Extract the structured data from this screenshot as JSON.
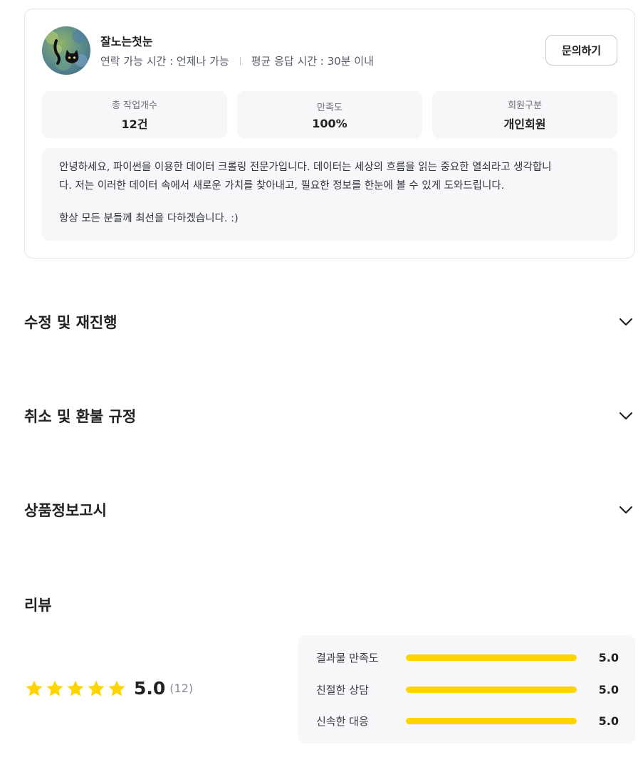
{
  "seller": {
    "name": "잘노는첫눈",
    "contact_time": "연락 가능 시간 : 언제나 가능",
    "avg_response": "평균 응답 시간 : 30분 이내",
    "inquiry_button": "문의하기",
    "stats": [
      {
        "label": "총 작업개수",
        "value": "12건"
      },
      {
        "label": "만족도",
        "value": "100%"
      },
      {
        "label": "회원구분",
        "value": "개인회원"
      }
    ],
    "intro_line1": "안녕하세요, 파이썬을 이용한 데이터 크롤링 전문가입니다. 데이터는 세상의 흐름을 읽는 중요한 열쇠라고 생각합니\n다. 저는 이러한 데이터 속에서 새로운 가치를 찾아내고, 필요한 정보를 한눈에 볼 수 있게 도와드립니다.",
    "intro_line2": "항상 모든 분들께 최선을 다하겠습니다. :)",
    "avatar_icon": "cat-avatar-image"
  },
  "accordions": [
    {
      "title": "수정 및 재진행",
      "icon": "chevron-down-icon"
    },
    {
      "title": "취소 및 환불 규정",
      "icon": "chevron-down-icon"
    },
    {
      "title": "상품정보고시",
      "icon": "chevron-down-icon"
    }
  ],
  "reviews": {
    "title": "리뷰",
    "rating": "5.0",
    "rating_value": 5.0,
    "count": "(12)",
    "star_color": "#ffd400",
    "breakdown": [
      {
        "label": "결과물 만족도",
        "score": "5.0",
        "fraction": 1.0
      },
      {
        "label": "친절한 상담",
        "score": "5.0",
        "fraction": 1.0
      },
      {
        "label": "신속한 대응",
        "score": "5.0",
        "fraction": 1.0
      }
    ]
  }
}
